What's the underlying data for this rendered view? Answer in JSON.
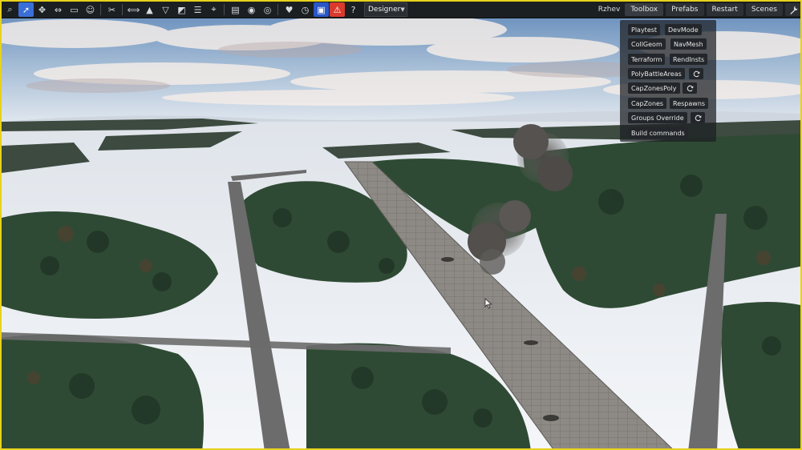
{
  "app": {
    "mode_select": "Designer",
    "map_name": "Rzhev",
    "menu": [
      "Toolbox",
      "Prefabs",
      "Restart",
      "Scenes"
    ]
  },
  "toolbar_icons": [
    "search-icon",
    "select-icon",
    "move-icon",
    "scale-icon",
    "object-icon",
    "face-icon",
    "scissors-icon",
    "flip-icon",
    "arrow-up-icon",
    "triangle-down-icon",
    "terrain-icon",
    "sliders-icon",
    "target-icon",
    "document-icon",
    "eye-icon",
    "eye-outline-icon",
    "heart-icon",
    "timer-icon",
    "lock-icon",
    "warning-icon",
    "help-icon"
  ],
  "panel": {
    "buttons": [
      "Playtest",
      "DevMode",
      "CollGeom",
      "NavMesh",
      "Terraform",
      "RendInsts",
      "PolyBattleAreas",
      "CapZonesPoly",
      "CapZones",
      "Respawns",
      "Groups Override",
      "Build commands"
    ]
  },
  "colors": {
    "frame": "#e8d21c",
    "toolbar_bg": "#1c1f22",
    "active_tool": "#3a6fd8",
    "warning_tool": "#d93a2c",
    "panel_bg": "#1c1e22"
  }
}
